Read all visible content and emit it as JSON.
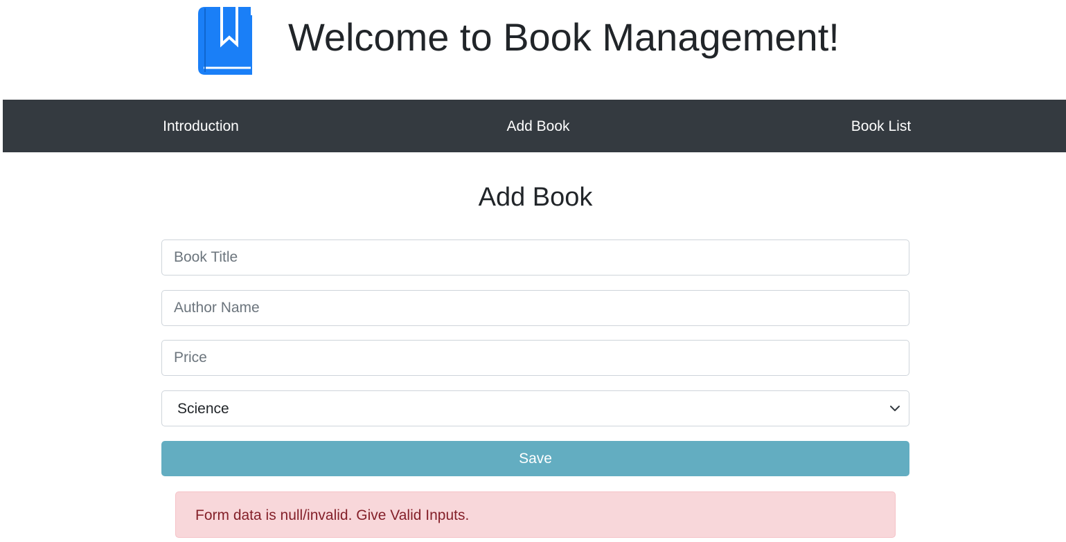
{
  "header": {
    "title": "Welcome to Book Management!",
    "logo_icon": "book-bookmark-icon",
    "logo_color": "#1a7ff7"
  },
  "nav": {
    "background": "#343a40",
    "items": [
      {
        "label": "Introduction"
      },
      {
        "label": "Add Book"
      },
      {
        "label": "Book List"
      }
    ]
  },
  "main": {
    "heading": "Add Book",
    "form": {
      "title": {
        "placeholder": "Book Title",
        "value": ""
      },
      "author": {
        "placeholder": "Author Name",
        "value": ""
      },
      "price": {
        "placeholder": "Price",
        "value": ""
      },
      "category": {
        "selected": "Science",
        "icon": "chevron-down-icon"
      },
      "save_label": "Save",
      "save_color": "#63adc1"
    },
    "alert": {
      "message": "Form data is null/invalid. Give Valid Inputs.",
      "background": "#f8d7da",
      "text_color": "#842029"
    }
  }
}
